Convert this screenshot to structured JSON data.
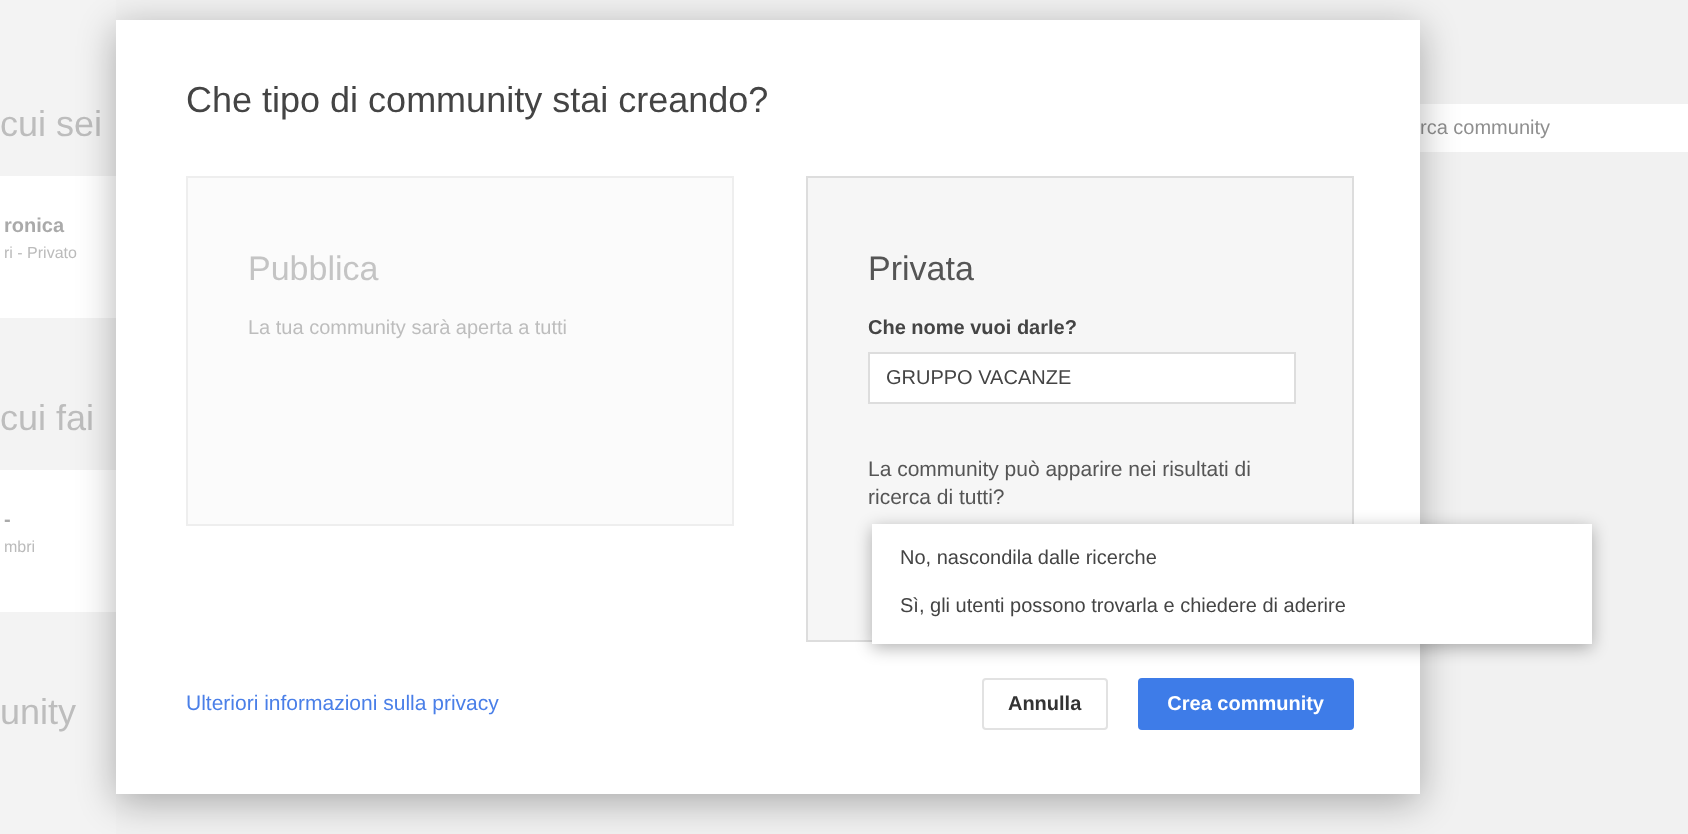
{
  "background": {
    "left": [
      {
        "kind": "heading",
        "text": "cui sei"
      },
      {
        "kind": "item",
        "title": "ronica",
        "subtitle": "ri - Privato"
      },
      {
        "kind": "heading",
        "text": "cui fai"
      },
      {
        "kind": "item",
        "title": "-",
        "subtitle": "mbri"
      },
      {
        "kind": "heading",
        "text": "unity"
      }
    ],
    "search": {
      "placeholder": "rca community"
    }
  },
  "dialog": {
    "title": "Che tipo di community stai creando?",
    "options": [
      {
        "title": "Pubblica",
        "description": "La tua community sarà aperta a tutti",
        "selected": false
      },
      {
        "title": "Privata",
        "selected": true,
        "field_label": "Che nome vuoi darle?",
        "field_value": "GRUPPO VACANZE",
        "question": "La community può apparire nei risultati di ricerca di tutti?"
      }
    ],
    "dropdown": [
      {
        "label": "No, nascondila dalle ricerche"
      },
      {
        "label": "Sì, gli utenti possono trovarla e chiedere di aderire"
      }
    ],
    "link": "Ulteriori informazioni sulla privacy",
    "buttons": [
      {
        "label": "Annulla",
        "kind": "secondary"
      },
      {
        "label": "Crea community",
        "kind": "primary"
      }
    ]
  }
}
